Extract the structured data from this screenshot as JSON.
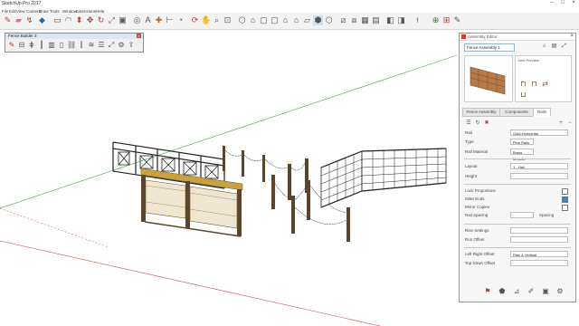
{
  "app": {
    "title": "SketchUp Pro 2017"
  },
  "menu": [
    "File",
    "Edit",
    "View",
    "Camera",
    "Draw",
    "Tools",
    "Window",
    "Extensions",
    "Help"
  ],
  "toolbar": {
    "icons": [
      "pencil-icon",
      "eraser-icon",
      "lasso-icon",
      "paint-bucket-icon",
      "shape-icon",
      "arc-icon",
      "rectangle-icon",
      "push-pull-icon",
      "move-icon",
      "rotate-icon",
      "scale-icon",
      "offset-icon",
      "tape-measure-icon",
      "text-icon",
      "axes-icon",
      "dimension-icon",
      "protractor-icon",
      "orbit-icon",
      "pan-icon",
      "zoom-icon",
      "zoom-extents-icon",
      "iso-view-icon",
      "top-view-icon",
      "front-view-icon",
      "right-view-icon",
      "back-view-icon",
      "left-view-icon",
      "bottom-view-icon",
      "xray-icon",
      "wireframe-icon",
      "hidden-line-icon",
      "shaded-icon",
      "shaded-textures-icon",
      "monochrome-icon",
      "section-plane-icon",
      "section-display-icon",
      "section-cut-icon",
      "warehouse-icon",
      "extension-warehouse-icon",
      "layout-icon",
      "extension-manager-icon"
    ]
  },
  "floating_toolbar": {
    "title": "Fence Builder 3",
    "icons": [
      "pencil-icon",
      "rail-icon",
      "fence-icon",
      "post-icon",
      "panel-icon",
      "gate-icon",
      "chain-icon",
      "picket-icon",
      "wire-icon",
      "layer-icon",
      "scale-icon",
      "settings-icon",
      "export-icon",
      "help-icon"
    ]
  },
  "panel": {
    "title": "Assembly Editor",
    "component_name": "Fence Assembly 1",
    "preview_label": "Joint Preview",
    "tabs": [
      "Fence Assembly",
      "Components",
      "Rails"
    ],
    "active_tab": "Rails",
    "fields": [
      {
        "label": "Rail",
        "value": "Gold-Horizontal"
      },
      {
        "label": "Type",
        "value": "Pine Rails"
      },
      {
        "label": "Rail Material",
        "value": "Brass Metallic"
      },
      {
        "label": "Layout",
        "value": "1 - Hall"
      },
      {
        "label": "Height",
        "value": ""
      }
    ],
    "toggles": [
      {
        "label": "Lock Proportions",
        "checked": false
      },
      {
        "label": "Miter Ends",
        "checked": true
      },
      {
        "label": "Mirror Copies",
        "checked": false
      }
    ],
    "spacing": {
      "label": "Rail Spacing",
      "value": "",
      "unit": "Spacing"
    },
    "extra_fields": [
      {
        "label": "Rise Settings",
        "value": ""
      },
      {
        "label": "Run Offset",
        "value": ""
      },
      {
        "label": "Left Right Offset",
        "value": "Rise & Vertical"
      },
      {
        "label": "Top Down Offset",
        "value": ""
      }
    ],
    "bottom_tools": [
      "select-icon",
      "paint-icon",
      "measure-icon",
      "picker-icon",
      "component-icon",
      "settings-icon"
    ]
  },
  "colors": {
    "axis_red": "#c94a4a",
    "axis_green": "#4aa84a",
    "rail_gold": "#c9a23f",
    "post_brown": "#5a4630",
    "accent": "#d63b2c"
  }
}
